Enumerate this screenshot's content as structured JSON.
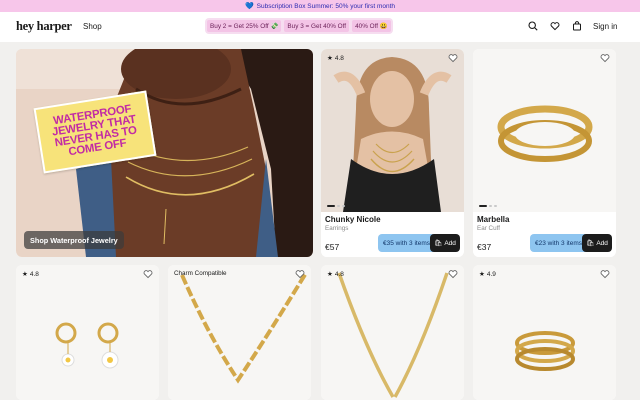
{
  "announcement": {
    "icon": "heart-icon",
    "text": "Subscription Box Summer: 50% your first month"
  },
  "header": {
    "logo": "hey harper",
    "shop": "Shop",
    "promos": [
      "Buy 2 = Get 25% Off 💸",
      "Buy 3 = Get 40% Off",
      "40% Off 😃"
    ],
    "sign_in": "Sign in",
    "icons": [
      "search-icon",
      "heart-icon",
      "bag-icon"
    ]
  },
  "hero": {
    "sticker": "WATERPROOF JEWELRY THAT NEVER HAS TO COME OFF",
    "cta": "Shop Waterproof Jewelry"
  },
  "products": [
    {
      "rating": "4.8",
      "name": "Chunky Nicole",
      "subtitle": "Earrings",
      "price": "€57",
      "bundle": "€35 with 3 items",
      "add": "Add"
    },
    {
      "rating": "",
      "name": "Marbella",
      "subtitle": "Ear Cuff",
      "price": "€37",
      "bundle": "€23 with 3 items",
      "add": "Add"
    }
  ],
  "row2": [
    {
      "rating": "4.8",
      "badge": ""
    },
    {
      "rating": "",
      "badge": "Charm Compatible"
    },
    {
      "rating": "4.8",
      "badge": ""
    },
    {
      "rating": "4.9",
      "badge": ""
    }
  ],
  "colors": {
    "announcement_bg": "#f7c6ea",
    "promo_bg": "#f3c4e6",
    "bundle_bg": "#8ec5f0",
    "add_bg": "#1c1c1c",
    "sticker_text": "#c22ba4",
    "sticker_bg": "#f7e37a"
  }
}
